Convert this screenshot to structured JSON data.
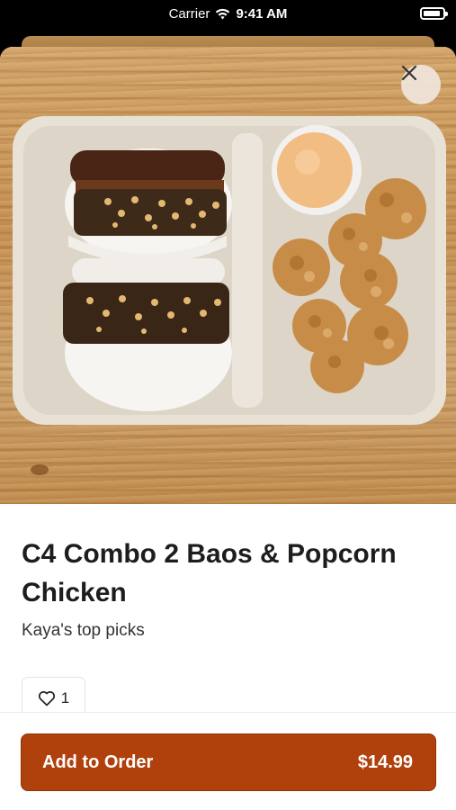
{
  "status_bar": {
    "carrier": "Carrier",
    "time": "9:41 AM"
  },
  "item": {
    "title": "C4 Combo 2 Baos & Popcorn Chicken",
    "subtitle": "Kaya's top picks",
    "like_count": "1"
  },
  "footer": {
    "add_label": "Add to Order",
    "price": "$14.99"
  },
  "colors": {
    "primary_button": "#b0400c",
    "text": "#1d1d1d"
  },
  "icons": {
    "close": "close-icon",
    "heart": "heart-icon",
    "wifi": "wifi-icon",
    "battery": "battery-icon"
  }
}
